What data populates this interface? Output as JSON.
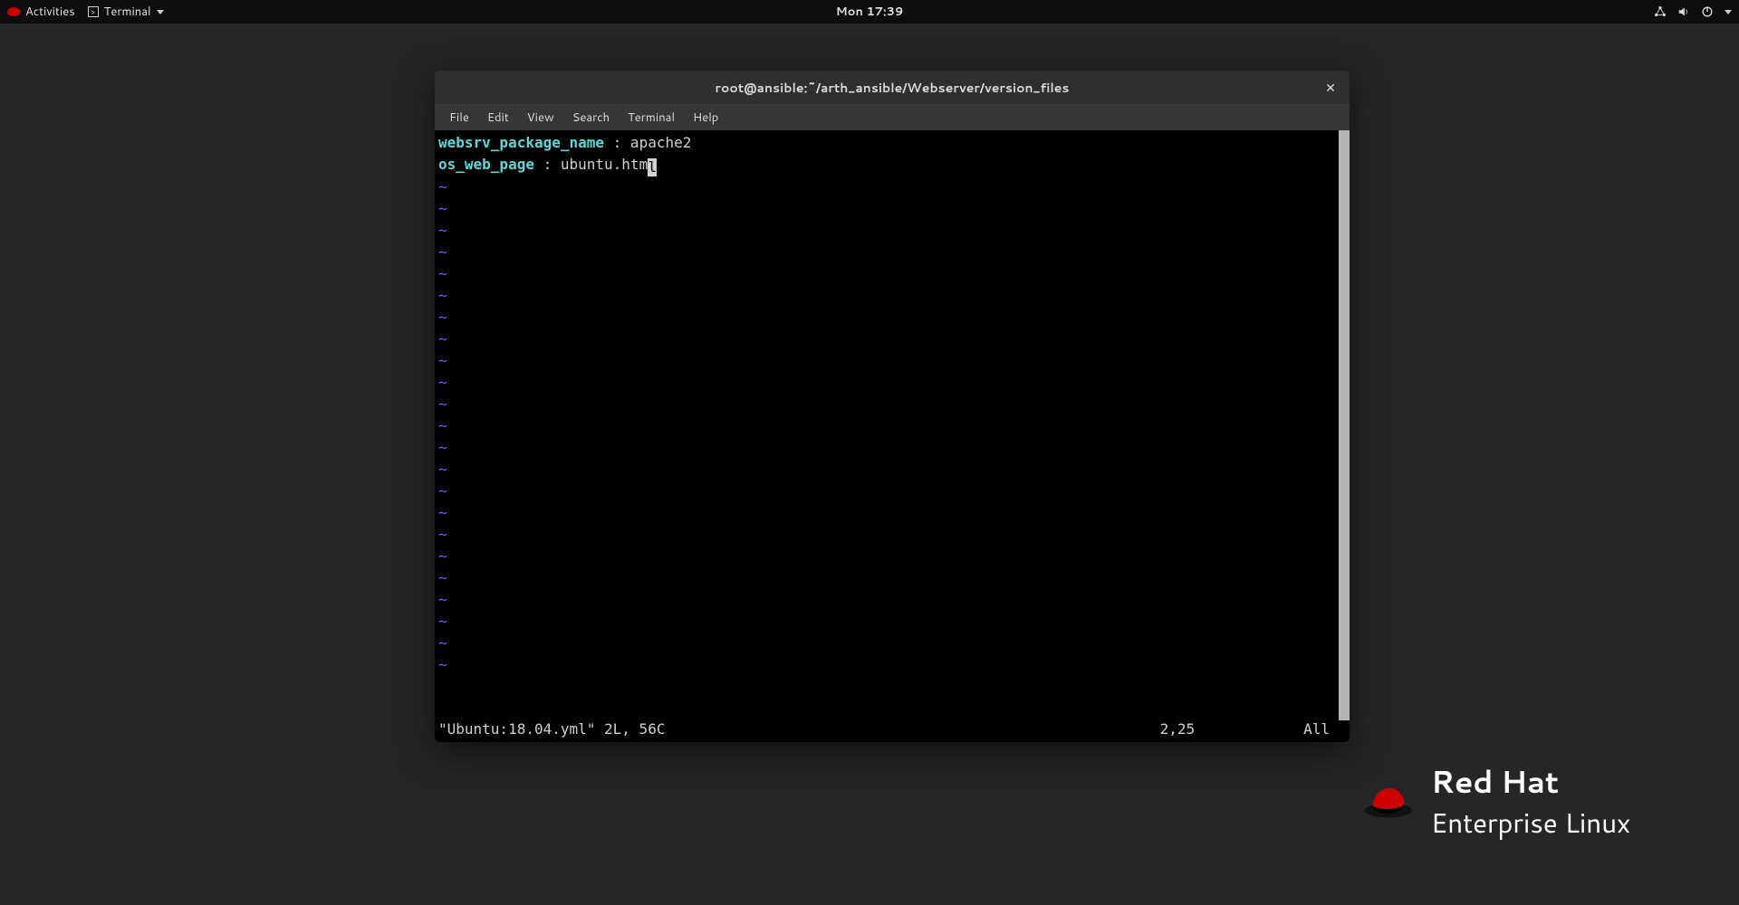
{
  "topbar": {
    "activities_label": "Activities",
    "app_label": "Terminal",
    "clock": "Mon 17:39"
  },
  "window": {
    "title": "root@ansible:~/arth_ansible/Webserver/version_files",
    "menus": [
      "File",
      "Edit",
      "View",
      "Search",
      "Terminal",
      "Help"
    ]
  },
  "editor": {
    "lines": [
      {
        "key": "websrv_package_name",
        "sep": " : ",
        "val": "apache2",
        "cursor": false
      },
      {
        "key": "os_web_page",
        "sep": " : ",
        "val": "ubuntu.htm",
        "cursor": true,
        "cursor_char": "l"
      }
    ],
    "tilde_rows": 23,
    "status": {
      "file": "\"Ubuntu:18.04.yml\" 2L, 56C",
      "pos": "2,25",
      "scroll": "All"
    }
  },
  "branding": {
    "line1": "Red Hat",
    "line2": "Enterprise Linux"
  }
}
